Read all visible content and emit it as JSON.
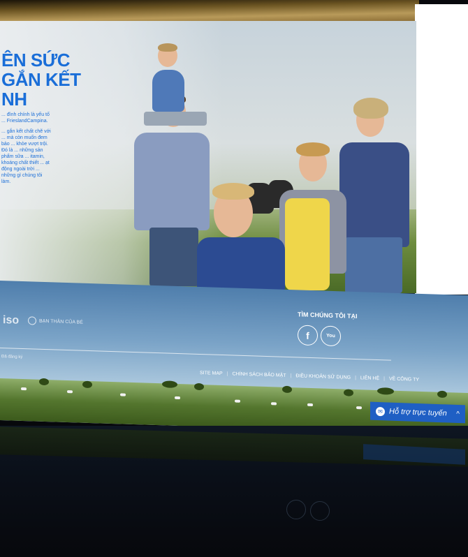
{
  "hero": {
    "title_lines": [
      "ÊN SỨC",
      "GẮN KẾT",
      "NH"
    ],
    "paragraph_1": "... đình chính là yếu tố ... FrieslandCampina.",
    "paragraph_2": "... gắn kết chất chẽ với ... mà còn muốn đem bảo ... khỏe vượt trội. Đó là ... những sản phẩm sữa ... itamin, khoáng chất thiết ... ạt động ngoài trời ... những gì chúng tôi làm."
  },
  "footer": {
    "logo_left": "iso",
    "logo_partner": "BẠN THÂN CỦA BÉ",
    "find_us_label": "TÌM CHÚNG TÔI TẠI",
    "facebook_glyph": "f",
    "youtube_glyph": "You",
    "copyright": "Đã đăng ký",
    "links": [
      "SITE MAP",
      "CHÍNH SÁCH BẢO MẬT",
      "ĐIỀU KHOẢN SỬ DỤNG",
      "LIÊN HỆ",
      "VỀ CÔNG TY"
    ]
  },
  "chat": {
    "label": "Hỗ trợ trực tuyến",
    "icon": "messenger-icon",
    "chevron": "^"
  },
  "colors": {
    "brand_blue": "#1a6ed8",
    "chat_blue": "#1f5fc4"
  }
}
